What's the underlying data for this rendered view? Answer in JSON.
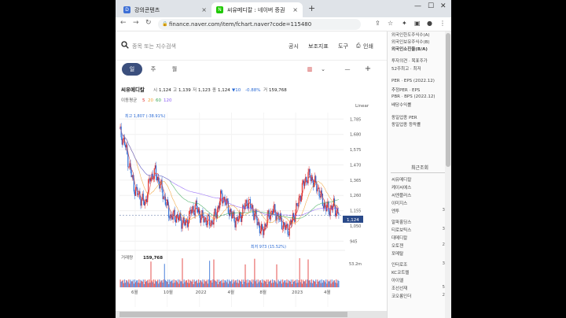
{
  "browser": {
    "tabs": [
      {
        "title": "강의콘텐츠",
        "active": false,
        "favicon_color": "#3d6fd6",
        "favicon_letter": "D"
      },
      {
        "title": "씨유메디칼 : 네이버 증권",
        "active": true,
        "favicon_color": "#1ec800",
        "favicon_letter": "N"
      }
    ],
    "url": "finance.naver.com/item/fchart.naver?code=115480",
    "new_tab": "+",
    "close": "×"
  },
  "toolbar": {
    "search_placeholder": "종목 또는 지수검색",
    "items": [
      "공시",
      "보조지표",
      "도구",
      "인쇄"
    ]
  },
  "periods": {
    "items": [
      "일",
      "주",
      "월"
    ],
    "selected": "일"
  },
  "stock": {
    "name": "씨유메디칼",
    "open_label": "시",
    "open": "1,124",
    "high_label": "고",
    "high": "1,139",
    "low_label": "저",
    "low": "1,123",
    "close_label": "종",
    "close": "1,124",
    "change": "▼10",
    "change_pct": "-0.88%",
    "volume_label": "거",
    "volume": "159,768",
    "ma_label": "이동평균",
    "ma": [
      "5",
      "20",
      "60",
      "120"
    ],
    "scale": "Linear",
    "max_label": "최고 1,807 (-38.91%)",
    "min_label": "최저 973 (15.52%)",
    "current_price_tag": "1,124",
    "volume_caption": "거래량",
    "volume_value": "159,768",
    "volume_axis": "53.2m"
  },
  "chart_data": {
    "type": "line",
    "title": "씨유메디칼",
    "y_ticks": [
      1785,
      1680,
      1575,
      1470,
      1365,
      1260,
      1155,
      1050,
      945
    ],
    "ylim": [
      920,
      1830
    ],
    "x_ticks": [
      "6월",
      "10월",
      "2022",
      "4월",
      "8월",
      "2023",
      "4월"
    ],
    "series": [
      {
        "name": "종가",
        "values": [
          1700,
          1620,
          1450,
          1300,
          1250,
          1200,
          1380,
          1420,
          1330,
          1220,
          1110,
          1120,
          1090,
          1060,
          1150,
          1180,
          1110,
          1090,
          1070,
          1140,
          1260,
          1200,
          1120,
          1080,
          1140,
          1220,
          1170,
          1080,
          1000,
          1100,
          1160,
          1120,
          1060,
          1020,
          1100,
          1200,
          1330,
          1400,
          1360,
          1300,
          1200,
          1160,
          1190,
          1124
        ]
      }
    ],
    "colors": {
      "up": "#e0312f",
      "down": "#2a6ad4",
      "ma5": "#e0312f",
      "ma20": "#f0a032",
      "ma60": "#3aa757",
      "ma120": "#8b5cf6"
    }
  },
  "sidebar": {
    "top_items": [
      "외국인한도주식수(A)",
      "외국인보유주식수(B)",
      "외국인소진율(B/A)",
      "투자의견 · 목표주가",
      "52주최고 · 최저",
      "PER · EPS (2022.12)",
      "추정PER · EPS",
      "PBR · BPS (2022.12)",
      "배당수익률",
      "동일업종 PER",
      "동일업종 등락률"
    ],
    "recent_title": "최근조회",
    "recent": [
      {
        "name": "씨유메디칼",
        "n": ""
      },
      {
        "name": "케이씨에스",
        "n": ""
      },
      {
        "name": "씨엔플러스",
        "n": ""
      },
      {
        "name": "이미지스",
        "n": ""
      },
      {
        "name": "엔투",
        "n": "3"
      },
      {
        "name": "알파홀딩스",
        "n": ""
      },
      {
        "name": "티로보틱스",
        "n": "3"
      },
      {
        "name": "대메디칼",
        "n": ""
      },
      {
        "name": "오토젠",
        "n": "2"
      },
      {
        "name": "포메탈",
        "n": ""
      },
      {
        "name": "인터로조",
        "n": "3"
      },
      {
        "name": "KC코트렐",
        "n": ""
      },
      {
        "name": "아이엘",
        "n": ""
      },
      {
        "name": "조선선재",
        "n": "5"
      },
      {
        "name": "코오롱인더",
        "n": "2"
      }
    ]
  }
}
